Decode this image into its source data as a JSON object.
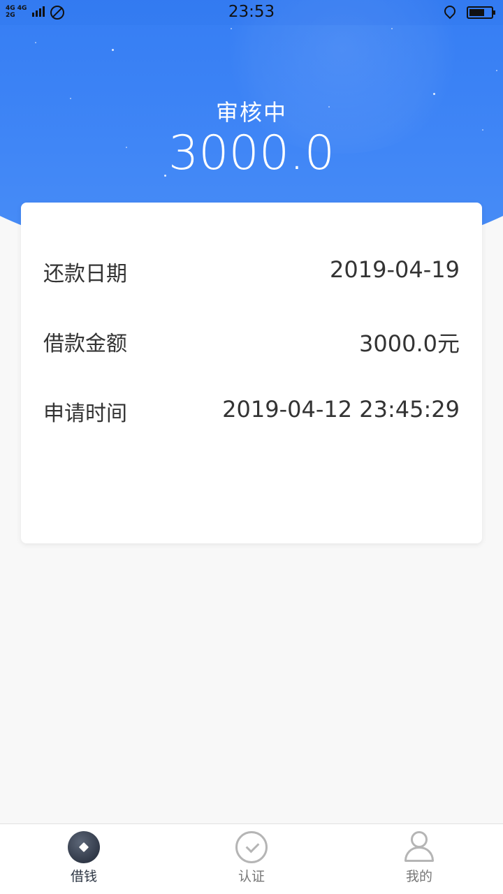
{
  "status_bar": {
    "network_top": "4G 4G",
    "network_bottom": "2G",
    "time": "23:53",
    "battery_level": 0.7
  },
  "header": {
    "status_title": "审核中",
    "amount": "3000.0",
    "background_color": "#2f78f0"
  },
  "details": [
    {
      "label": "还款日期",
      "value": "2019-04-19"
    },
    {
      "label": "借款金额",
      "value": "3000.0元"
    },
    {
      "label": "申请时间",
      "value": "2019-04-12 23:45:29"
    }
  ],
  "tabbar": {
    "tabs": [
      {
        "label": "借钱",
        "icon": "borrow-icon",
        "active": true
      },
      {
        "label": "认证",
        "icon": "check-circle-icon",
        "active": false
      },
      {
        "label": "我的",
        "icon": "user-icon",
        "active": false
      }
    ]
  }
}
